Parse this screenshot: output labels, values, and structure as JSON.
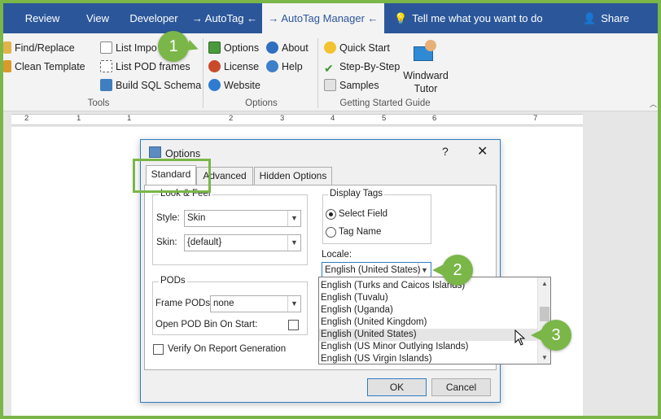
{
  "ribbon_tabs": [
    "Review",
    "View",
    "Developer",
    "→ AutoTag ←",
    "→ AutoTag Manager ←"
  ],
  "tell_me": "Tell me what you want to do",
  "share": "Share",
  "tools": {
    "find_replace": "Find/Replace",
    "clean_template": "Clean Template",
    "list_import": "List Impo",
    "list_pod_frames": "List POD frames",
    "build_sql": "Build SQL Schema",
    "group": "Tools"
  },
  "options_group": {
    "options": "Options",
    "license": "License",
    "website": "Website",
    "about": "About",
    "help": "Help",
    "group": "Options"
  },
  "getting_started": {
    "quick_start": "Quick Start",
    "step_by_step": "Step-By-Step",
    "samples": "Samples",
    "windward_tutor_line1": "Windward",
    "windward_tutor_line2": "Tutor",
    "group": "Getting Started Guide"
  },
  "ruler_numbers": [
    "2",
    "1",
    "1",
    "2",
    "3",
    "4",
    "5",
    "6",
    "7"
  ],
  "dialog": {
    "title": "Options",
    "help": "?",
    "close": "✕",
    "tabs": [
      "Standard",
      "Advanced",
      "Hidden Options"
    ],
    "look_feel": {
      "title": "Look & Feel",
      "style_label": "Style:",
      "style_value": "Skin",
      "skin_label": "Skin:",
      "skin_value": "{default}"
    },
    "display_tags": {
      "title": "Display Tags",
      "select_field": "Select Field",
      "tag_name": "Tag Name"
    },
    "pods": {
      "title": "PODs",
      "frame_label": "Frame PODs:",
      "frame_value": "none",
      "open_bin": "Open POD Bin On Start:"
    },
    "verify": "Verify On Report Generation",
    "locale_label": "Locale:",
    "locale_value": "English (United States)",
    "ok": "OK",
    "cancel": "Cancel"
  },
  "locale_options": [
    "English (Turks and Caicos Islands)",
    "English (Tuvalu)",
    "English (Uganda)",
    "English (United Kingdom)",
    "English (United States)",
    "English (US Minor Outlying Islands)",
    "English (US Virgin Islands)"
  ],
  "callouts": [
    "1",
    "2",
    "3"
  ],
  "colors": {
    "ribbon_blue": "#2b579a",
    "callout_green": "#7ab648",
    "dialog_border": "#2d7dc2"
  }
}
